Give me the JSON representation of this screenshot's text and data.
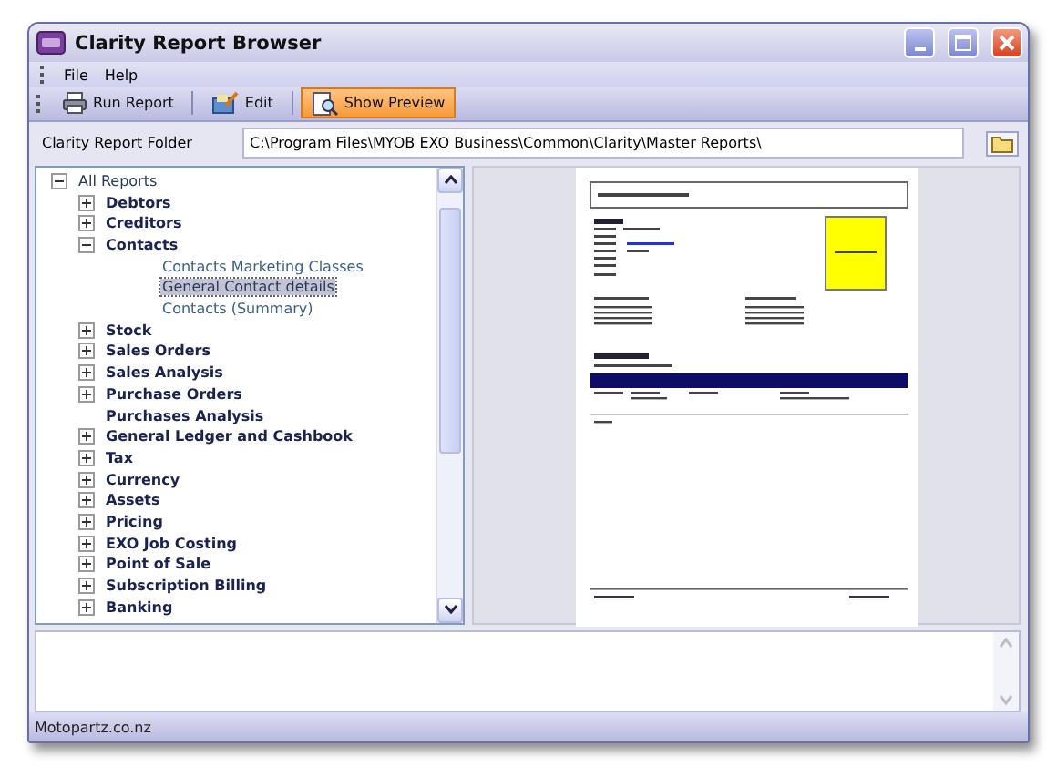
{
  "window": {
    "title": "Clarity Report Browser"
  },
  "menu": [
    "File",
    "Help"
  ],
  "toolbar": [
    {
      "kind": "print",
      "label": "Run Report",
      "pressed": false
    },
    {
      "kind": "edit",
      "label": "Edit",
      "pressed": false
    },
    {
      "kind": "preview",
      "label": "Show Preview",
      "pressed": true
    }
  ],
  "folder": {
    "label": "Clarity Report Folder",
    "value": "C:\\Program Files\\MYOB EXO Business\\Common\\Clarity\\Master Reports\\"
  },
  "tree": {
    "label": "All Reports",
    "expanded": true,
    "children": [
      {
        "label": "Debtors",
        "expanded": false
      },
      {
        "label": "Creditors",
        "expanded": false
      },
      {
        "label": "Contacts",
        "expanded": true,
        "children": [
          {
            "label": "Contacts Marketing Classes",
            "selected": false
          },
          {
            "label": "General Contact details",
            "selected": true
          },
          {
            "label": "Contacts (Summary)",
            "selected": false
          }
        ]
      },
      {
        "label": "Stock",
        "expanded": false
      },
      {
        "label": "Sales Orders",
        "expanded": false
      },
      {
        "label": "Sales Analysis",
        "expanded": false
      },
      {
        "label": "Purchase Orders",
        "expanded": false
      },
      {
        "label": "Purchases Analysis"
      },
      {
        "label": "General Ledger and Cashbook",
        "expanded": false
      },
      {
        "label": "Tax",
        "expanded": false
      },
      {
        "label": "Currency",
        "expanded": false
      },
      {
        "label": "Assets",
        "expanded": false
      },
      {
        "label": "Pricing",
        "expanded": false
      },
      {
        "label": "EXO Job Costing",
        "expanded": false
      },
      {
        "label": "Point of Sale",
        "expanded": false
      },
      {
        "label": "Subscription Billing",
        "expanded": false
      },
      {
        "label": "Banking",
        "expanded": false
      }
    ]
  },
  "status_bar": "Motopartz.co.nz"
}
